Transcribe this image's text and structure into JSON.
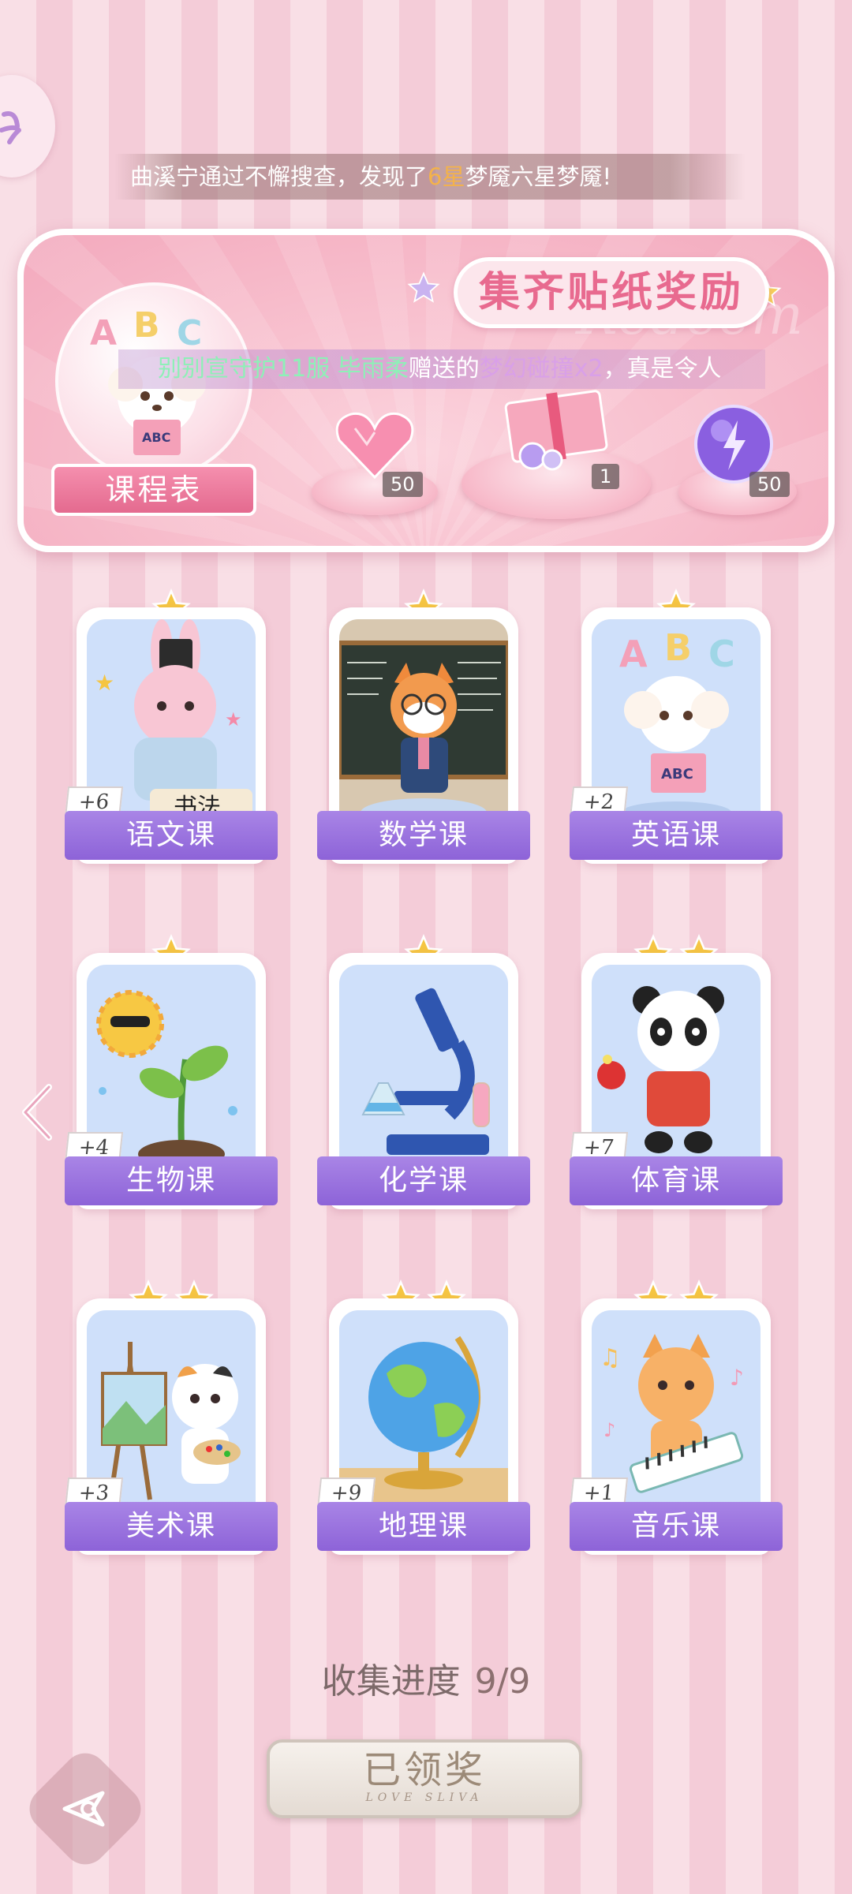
{
  "marquee": {
    "before": "曲溪宁通过不懈搜查，发现了",
    "highlight": "6星",
    "after": "梦魇六星梦魇!"
  },
  "banner": {
    "title": "集齐贴纸奖励",
    "watermark": "Redeem",
    "notice": {
      "green_part": "别别宣守护11服 毕雨柔",
      "mid_part": "赠送的",
      "purple_part": "梦幻碰撞x2",
      "end_part": "，真是令人"
    },
    "schedule_button": "课程表",
    "rewards": [
      {
        "name": "heart-gem",
        "count": "50"
      },
      {
        "name": "gift-box",
        "count": "1"
      },
      {
        "name": "lightning-orb",
        "count": "50"
      }
    ]
  },
  "courses": [
    {
      "label": "语文课",
      "bonus": "+6",
      "stars": 1,
      "icon": "bunny-calligraphy"
    },
    {
      "label": "数学课",
      "bonus": "",
      "stars": 1,
      "icon": "fox-teacher"
    },
    {
      "label": "英语课",
      "bonus": "+2",
      "stars": 1,
      "icon": "puppy-abc"
    },
    {
      "label": "生物课",
      "bonus": "+4",
      "stars": 1,
      "icon": "sun-sprout"
    },
    {
      "label": "化学课",
      "bonus": "",
      "stars": 1,
      "icon": "microscope"
    },
    {
      "label": "体育课",
      "bonus": "+7",
      "stars": 2,
      "icon": "panda-pingpong"
    },
    {
      "label": "美术课",
      "bonus": "+3",
      "stars": 2,
      "icon": "cat-painter"
    },
    {
      "label": "地理课",
      "bonus": "+9",
      "stars": 2,
      "icon": "globe"
    },
    {
      "label": "音乐课",
      "bonus": "+1",
      "stars": 2,
      "icon": "cat-keyboard"
    }
  ],
  "progress": {
    "label": "收集进度",
    "value": "9/9"
  },
  "claim_button": {
    "label": "已领奖",
    "subtitle": "LOVE SLIVA"
  },
  "colors": {
    "accent_pink": "#e86a8f",
    "label_purple": "#8d63d8",
    "star_gold": "#f5c542"
  }
}
